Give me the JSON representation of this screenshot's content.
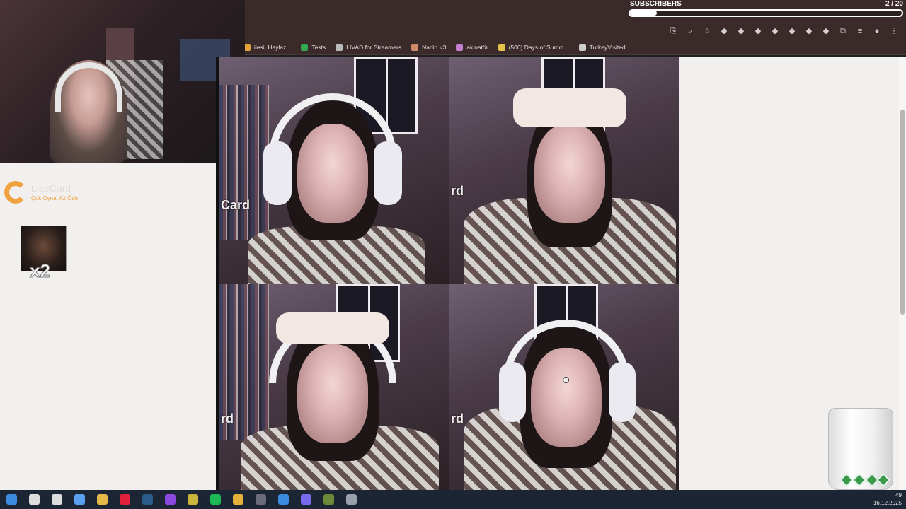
{
  "subscribers": {
    "label": "SUBSCRIBERS",
    "count": "2 / 20",
    "progress": 0.1
  },
  "bookmarks": [
    {
      "label": "ilesi, Haylaz...",
      "icon": "folder-icon",
      "color": "#e0a23a"
    },
    {
      "label": "Tests",
      "icon": "sheets-icon",
      "color": "#34a853"
    },
    {
      "label": "LIVAD for Streamers",
      "icon": "livad-icon",
      "color": "#bbbbbb"
    },
    {
      "label": "Nadin <3",
      "icon": "nadin-icon",
      "color": "#d08a6a"
    },
    {
      "label": "akinatör",
      "icon": "akinator-icon",
      "color": "#c17fd0"
    },
    {
      "label": "(500) Days of Summ...",
      "icon": "film-icon",
      "color": "#e5c24a"
    },
    {
      "label": "TurkeyVisited",
      "icon": "globe-icon",
      "color": "#cccccc"
    }
  ],
  "toolbar_icons": [
    "cast-icon",
    "zoom-icon",
    "star-icon",
    "ext-blue-icon",
    "ext-red-icon",
    "ext-shield-icon",
    "ext-record-icon",
    "ext-translate-icon",
    "ext-shield2-icon",
    "ext-box-icon",
    "puzzle-icon",
    "playlist-icon",
    "profile-icon",
    "menu-icon"
  ],
  "left_panel": {
    "logo_text": "LikeCard",
    "logo_sub": "Çok Oyna, Az Öde",
    "multiplier": "x2"
  },
  "collage_tag": "Card",
  "collage_tag_short": "rd",
  "taskbar_icons": [
    {
      "name": "windows-start-icon",
      "color": "#3c8be0"
    },
    {
      "name": "search-icon",
      "color": "#dddddd"
    },
    {
      "name": "task-view-icon",
      "color": "#dddddd"
    },
    {
      "name": "copilot-icon",
      "color": "#5aa0f0"
    },
    {
      "name": "file-explorer-icon",
      "color": "#e6b84a"
    },
    {
      "name": "opera-icon",
      "color": "#e0203c"
    },
    {
      "name": "steam-icon",
      "color": "#2a5c8a"
    },
    {
      "name": "twitch-icon",
      "color": "#8a4ae0"
    },
    {
      "name": "app-yellow-icon",
      "color": "#c9b53a"
    },
    {
      "name": "spotify-icon",
      "color": "#1db954"
    },
    {
      "name": "chrome-icon",
      "color": "#e5b13a"
    },
    {
      "name": "obs-icon",
      "color": "#6a6a7a"
    },
    {
      "name": "chrome-alt-icon",
      "color": "#3a8ae0"
    },
    {
      "name": "discord-icon",
      "color": "#7a6af0"
    },
    {
      "name": "game-icon",
      "color": "#6a8a3a"
    },
    {
      "name": "folder-icon",
      "color": "#9aa0aa"
    }
  ],
  "clock": {
    "time": "49",
    "date": "16.12.2025"
  }
}
